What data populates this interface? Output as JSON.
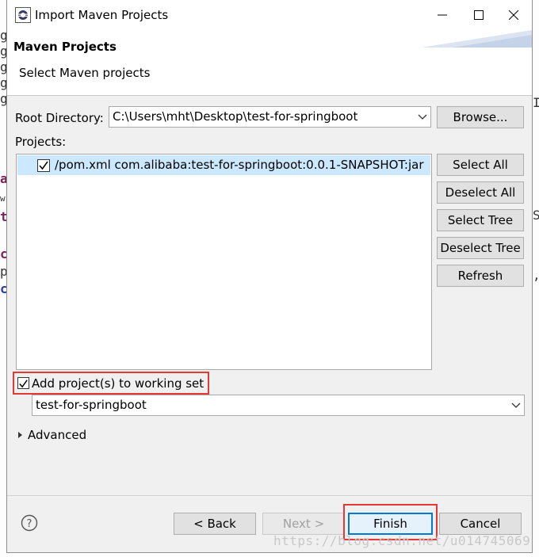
{
  "window": {
    "title": "Import Maven Projects",
    "minimize_icon": "minimize-icon",
    "maximize_icon": "maximize-icon",
    "close_icon": "close-icon"
  },
  "banner": {
    "title": "Maven Projects",
    "subtitle": "Select Maven projects"
  },
  "root_directory": {
    "label": "Root Directory:",
    "value": "C:\\Users\\mht\\Desktop\\test-for-springboot",
    "browse_label": "Browse..."
  },
  "projects": {
    "label": "Projects:",
    "items": [
      {
        "checked": true,
        "text": "/pom.xml  com.alibaba:test-for-springboot:0.0.1-SNAPSHOT:jar"
      }
    ],
    "buttons": {
      "select_all": "Select All",
      "deselect_all": "Deselect All",
      "select_tree": "Select Tree",
      "deselect_tree": "Deselect Tree",
      "refresh": "Refresh"
    }
  },
  "working_set": {
    "checked": true,
    "label": "Add project(s) to working set",
    "value": "test-for-springboot"
  },
  "advanced": {
    "label": "Advanced"
  },
  "footer": {
    "back": "< Back",
    "next": "Next >",
    "finish": "Finish",
    "cancel": "Cancel"
  },
  "watermark": "https://blog.csdn.net/u014745069",
  "background_glyphs": [
    "g",
    "g",
    "g",
    "g",
    "g",
    "a",
    "w",
    "t",
    "c",
    "p",
    "c",
    "S",
    "I",
    "S",
    ","
  ],
  "colors": {
    "highlight_red": "#e53935",
    "selection_blue": "#cce8ff",
    "default_button_border": "#0078d7"
  }
}
